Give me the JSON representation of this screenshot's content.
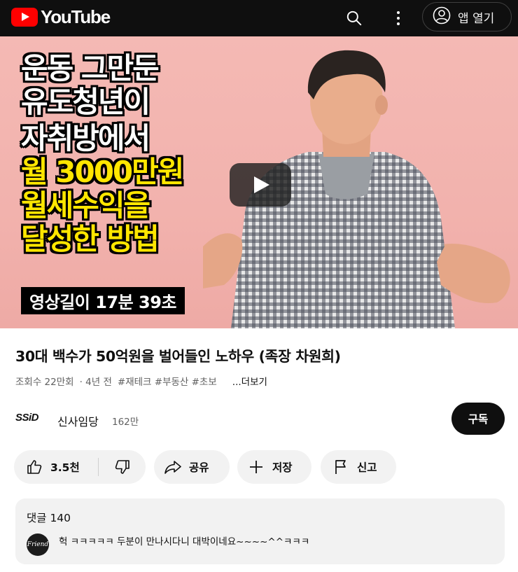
{
  "header": {
    "logo_text": "YouTube",
    "open_app_label": "앱 열기",
    "icons": [
      "youtube-logo",
      "search-icon",
      "more-vert-icon",
      "account-icon"
    ]
  },
  "video": {
    "thumbnail_lines": [
      {
        "text": "운동 그만둔",
        "color": "white"
      },
      {
        "text": "유도청년이",
        "color": "white"
      },
      {
        "text": "자취방에서",
        "color": "white"
      },
      {
        "text": "월 3000만원",
        "color": "yellow"
      },
      {
        "text": "월세수익을",
        "color": "yellow"
      },
      {
        "text": "달성한 방법",
        "color": "yellow"
      }
    ],
    "duration_badge": "영상길이 17분 39초",
    "title": "30대 백수가 50억원을 벌어들인 노하우 (족장 차원희)",
    "views": "조회수 22만회",
    "age": "· 4년 전",
    "tags": "#재테크 #부동산 #초보",
    "more_label": "...더보기"
  },
  "channel": {
    "logo_text": "SSiD",
    "name": "신사임당",
    "subscribers": "162만",
    "subscribe_label": "구독"
  },
  "actions": {
    "like_count": "3.5천",
    "share_label": "공유",
    "save_label": "저장",
    "report_label": "신고"
  },
  "comments": {
    "header": "댓글 140",
    "top_comment_avatar_text": "Friend",
    "top_comment": "헉 ㅋㅋㅋㅋㅋ 두분이 만나시다니 대박이네요~~~~^^ㅋㅋㅋ"
  },
  "colors": {
    "brand_red": "#ff0000",
    "topbar_bg": "#0f0f0f",
    "pill_bg": "#f2f2f2",
    "thumbnail_yellow": "#ffe600",
    "thumbnail_bg": "#f4b9b4"
  }
}
